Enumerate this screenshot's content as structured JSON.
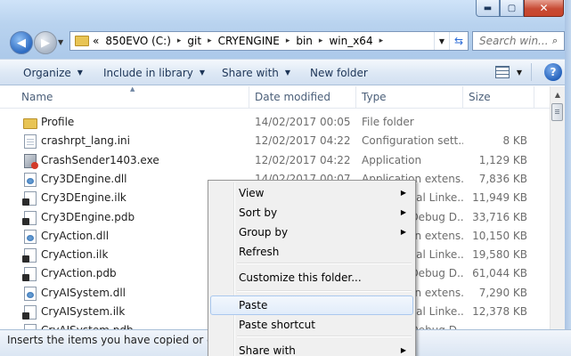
{
  "window": {
    "controls": {
      "minimize": "▬",
      "maximize": "▢",
      "close": "✕"
    }
  },
  "nav": {
    "back_icon": "arrow-left-icon",
    "forward_icon": "arrow-right-icon",
    "chevron": "«"
  },
  "address": {
    "crumbs": [
      "850EVO (C:)",
      "git",
      "CRYENGINE",
      "bin",
      "win_x64"
    ],
    "separator": "▸"
  },
  "search": {
    "placeholder": "Search win..."
  },
  "toolbar": {
    "organize": "Organize",
    "include": "Include in library",
    "share": "Share with",
    "new_folder": "New folder",
    "caret": "▼",
    "help": "?"
  },
  "columns": {
    "name": "Name",
    "date": "Date modified",
    "type": "Type",
    "size": "Size"
  },
  "files": [
    {
      "name": "Profile",
      "date": "14/02/2017 00:05",
      "type": "File folder",
      "size": "",
      "icon": "folder"
    },
    {
      "name": "crashrpt_lang.ini",
      "date": "12/02/2017 04:22",
      "type": "Configuration sett...",
      "size": "8 KB",
      "icon": "doc"
    },
    {
      "name": "CrashSender1403.exe",
      "date": "12/02/2017 04:22",
      "type": "Application",
      "size": "1,129 KB",
      "icon": "exe"
    },
    {
      "name": "Cry3DEngine.dll",
      "date": "14/02/2017 00:07",
      "type": "Application extens...",
      "size": "7,836 KB",
      "icon": "dll"
    },
    {
      "name": "Cry3DEngine.ilk",
      "date": "",
      "type": "Incremental Linke...",
      "size": "11,949 KB",
      "icon": "ilk"
    },
    {
      "name": "Cry3DEngine.pdb",
      "date": "",
      "type": "Program Debug D...",
      "size": "33,716 KB",
      "icon": "ilk"
    },
    {
      "name": "CryAction.dll",
      "date": "",
      "type": "Application extens...",
      "size": "10,150 KB",
      "icon": "dll"
    },
    {
      "name": "CryAction.ilk",
      "date": "",
      "type": "Incremental Linke...",
      "size": "19,580 KB",
      "icon": "ilk"
    },
    {
      "name": "CryAction.pdb",
      "date": "",
      "type": "Program Debug D...",
      "size": "61,044 KB",
      "icon": "ilk"
    },
    {
      "name": "CryAISystem.dll",
      "date": "",
      "type": "Application extens...",
      "size": "7,290 KB",
      "icon": "dll"
    },
    {
      "name": "CryAISystem.ilk",
      "date": "",
      "type": "Incremental Linke...",
      "size": "12,378 KB",
      "icon": "ilk"
    },
    {
      "name": "CryAISystem.pdb",
      "date": "",
      "type": "Program Debug D...",
      "size": "",
      "icon": "ilk"
    }
  ],
  "status": {
    "text": "Inserts the items you have copied or cut into the selected location."
  },
  "context_menu": {
    "submenu_arrow": "▶",
    "items": [
      {
        "label": "View",
        "submenu": true
      },
      {
        "label": "Sort by",
        "submenu": true
      },
      {
        "label": "Group by",
        "submenu": true
      },
      {
        "label": "Refresh",
        "submenu": false
      },
      {
        "label": "Customize this folder...",
        "submenu": false
      },
      {
        "label": "Paste",
        "submenu": false,
        "highlighted": true
      },
      {
        "label": "Paste shortcut",
        "submenu": false
      },
      {
        "label": "Share with",
        "submenu": true
      }
    ]
  }
}
